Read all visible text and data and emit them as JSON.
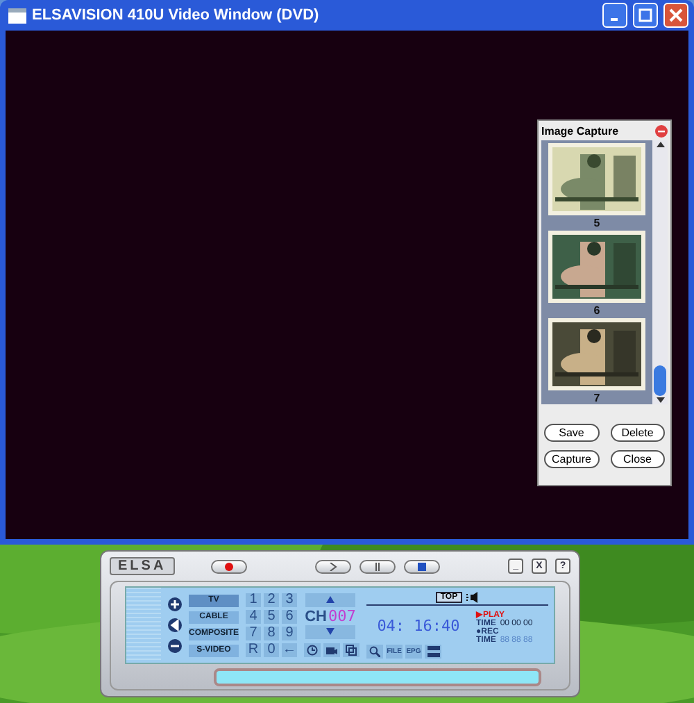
{
  "window": {
    "title": "ELSAVISION 410U Video Window (DVD)"
  },
  "capture_panel": {
    "title": "Image Capture",
    "thumbnails": [
      {
        "label": "5",
        "kind": "picture"
      },
      {
        "label": "6",
        "kind": "picture"
      },
      {
        "label": "7",
        "kind": "picture"
      }
    ],
    "buttons": [
      "Save",
      "Delete",
      "Capture",
      "Close"
    ]
  },
  "player": {
    "logo": "ELSA",
    "window_buttons": [
      "_",
      "X",
      "?"
    ],
    "sources": [
      {
        "label": "TV",
        "selected": true
      },
      {
        "label": "CABLE",
        "selected": false
      },
      {
        "label": "COMPOSITE",
        "selected": false
      },
      {
        "label": "S-VIDEO",
        "selected": false
      }
    ],
    "keypad": [
      "1",
      "2",
      "3",
      "4",
      "5",
      "6",
      "7",
      "8",
      "9",
      "R",
      "0",
      "←"
    ],
    "channel": {
      "label": "CH",
      "number": "007"
    },
    "top_badge": "TOP",
    "clock": "04: 16:40",
    "tools": [
      "FILE",
      "EPG"
    ],
    "status": [
      {
        "marker": "▶",
        "label": "PLAY",
        "kind": "header"
      },
      {
        "label": "TIME",
        "value": "00 00 00",
        "kind": "time"
      },
      {
        "marker": "●",
        "label": "REC",
        "kind": "header"
      },
      {
        "label": "TIME",
        "value": "88 88 88",
        "kind": "time-off"
      }
    ]
  }
}
